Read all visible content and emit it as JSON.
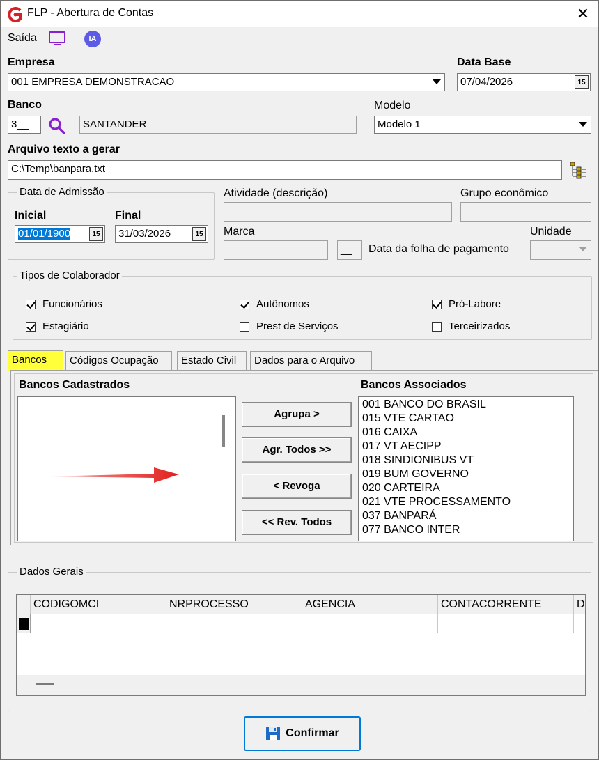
{
  "window": {
    "title": "FLP - Abertura de Contas"
  },
  "menu": {
    "saida_label": "Saída",
    "ia_label": "IA"
  },
  "empresa": {
    "label": "Empresa",
    "value": "001 EMPRESA DEMONSTRACAO"
  },
  "data_base": {
    "label": "Data Base",
    "value": "07/04/2026"
  },
  "banco": {
    "label": "Banco",
    "code": "3__",
    "name": "SANTANDER"
  },
  "modelo": {
    "label": "Modelo",
    "value": "Modelo 1"
  },
  "arquivo": {
    "label": "Arquivo texto a gerar",
    "value": "C:\\Temp\\banpara.txt"
  },
  "admissao": {
    "legend": "Data de Admissão",
    "inicial_label": "Inicial",
    "inicial_value": "01/01/1900",
    "final_label": "Final",
    "final_value": "31/03/2026"
  },
  "atividade": {
    "label": "Atividade (descrição)"
  },
  "grupo": {
    "label": "Grupo econômico"
  },
  "marca": {
    "label": "Marca"
  },
  "folha": {
    "label": "Data da folha de pagamento",
    "value": "__"
  },
  "unidade": {
    "label": "Unidade"
  },
  "tipos": {
    "legend": "Tipos de Colaborador",
    "items": [
      {
        "label": "Funcionários",
        "checked": true
      },
      {
        "label": "Autônomos",
        "checked": true
      },
      {
        "label": "Pró-Labore",
        "checked": true
      },
      {
        "label": "Estagiário",
        "checked": true
      },
      {
        "label": "Prest de Serviços",
        "checked": false
      },
      {
        "label": "Terceirizados",
        "checked": false
      }
    ]
  },
  "tabs": [
    {
      "label": "Bancos",
      "active": true
    },
    {
      "label": "Códigos Ocupação",
      "active": false
    },
    {
      "label": "Estado Civil",
      "active": false
    },
    {
      "label": "Dados para o Arquivo",
      "active": false
    }
  ],
  "bancos": {
    "cadastrados_label": "Bancos Cadastrados",
    "associados_label": "Bancos Associados",
    "associados": [
      "001 BANCO DO BRASIL",
      "015 VTE CARTAO",
      "016 CAIXA",
      "017 VT AECIPP",
      "018 SINDIONIBUS VT",
      "019 BUM GOVERNO",
      "020 CARTEIRA",
      "021 VTE PROCESSAMENTO",
      "037 BANPARÁ",
      "077 BANCO INTER"
    ],
    "buttons": {
      "agrupa": "Agrupa >",
      "agr_todos": "Agr. Todos >>",
      "revoga": "< Revoga",
      "rev_todos": "<< Rev. Todos"
    }
  },
  "dados_gerais": {
    "legend": "Dados Gerais",
    "columns": [
      "CODIGOMCI",
      "NRPROCESSO",
      "AGENCIA",
      "CONTACORRENTE",
      "D"
    ]
  },
  "confirmar_label": "Confirmar",
  "colors": {
    "highlight": "#ffff3a",
    "selection": "#0078d7",
    "arrow": "#e0201c",
    "brand": "#d71f26"
  }
}
